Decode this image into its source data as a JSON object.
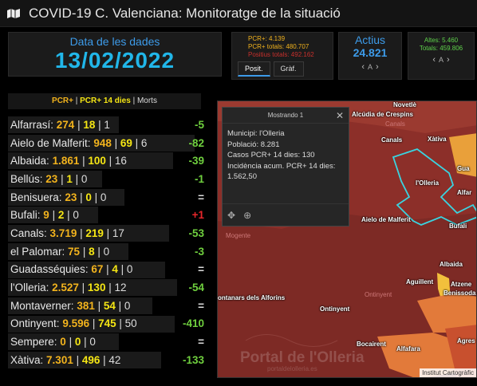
{
  "header": {
    "title": "COVID-19 C. Valenciana: Monitoratge de la situació"
  },
  "date_panel": {
    "label": "Data de les dades",
    "value": "13/02/2022"
  },
  "pcr_panel": {
    "pcr": "PCR+: 4.139",
    "pcr_total": "PCR+ totals: 480.707",
    "positius_total": "Positius totals: 492.162"
  },
  "tabs": [
    {
      "label": "Posit."
    },
    {
      "label": "Gràf."
    }
  ],
  "actius": {
    "label": "Actius",
    "value": "24.821",
    "pager_label": "A"
  },
  "altes": {
    "altes": "Altes: 5.460",
    "totals": "Totals: 459.806",
    "pager_label": "A"
  },
  "legend": {
    "a": "PCR+",
    "sep1": " | ",
    "b": "PCR+ 14 dies",
    "sep2": " | ",
    "c": "Morts"
  },
  "rows": [
    {
      "name": "Alfarrasí",
      "pcr": "274",
      "pcr14": "18",
      "morts": "1",
      "diff": "-5",
      "kind": "neg",
      "bar": 0.55
    },
    {
      "name": "Aielo de Malferit",
      "pcr": "948",
      "pcr14": "69",
      "morts": "6",
      "diff": "-82",
      "kind": "neg",
      "bar": 0.93
    },
    {
      "name": "Albaida",
      "pcr": "1.861",
      "pcr14": "100",
      "morts": "16",
      "diff": "-39",
      "kind": "neg",
      "bar": 0.82
    },
    {
      "name": "Bellús",
      "pcr": "23",
      "pcr14": "1",
      "morts": "0",
      "diff": "-1",
      "kind": "neg",
      "bar": 0.47
    },
    {
      "name": "Benisuera",
      "pcr": "23",
      "pcr14": "0",
      "morts": "0",
      "diff": "=",
      "kind": "eq",
      "bar": 0.58
    },
    {
      "name": "Bufali",
      "pcr": "9",
      "pcr14": "2",
      "morts": "0",
      "diff": "+1",
      "kind": "pos",
      "bar": 0.45
    },
    {
      "name": "Canals",
      "pcr": "3.719",
      "pcr14": "219",
      "morts": "17",
      "diff": "-53",
      "kind": "neg",
      "bar": 0.8
    },
    {
      "name": "el Palomar",
      "pcr": "75",
      "pcr14": "8",
      "morts": "0",
      "diff": "-3",
      "kind": "neg",
      "bar": 0.6
    },
    {
      "name": "Guadasséquies",
      "pcr": "67",
      "pcr14": "4",
      "morts": "0",
      "diff": "=",
      "kind": "eq",
      "bar": 0.78
    },
    {
      "name": "l'Olleria",
      "pcr": "2.527",
      "pcr14": "130",
      "morts": "12",
      "diff": "-54",
      "kind": "neg",
      "bar": 0.84
    },
    {
      "name": "Montaverner",
      "pcr": "381",
      "pcr14": "54",
      "morts": "0",
      "diff": "=",
      "kind": "eq",
      "bar": 0.72
    },
    {
      "name": "Ontinyent",
      "pcr": "9.596",
      "pcr14": "745",
      "morts": "50",
      "diff": "-410",
      "kind": "neg",
      "bar": 0.83
    },
    {
      "name": "Sempere",
      "pcr": "0",
      "pcr14": "0",
      "morts": "0",
      "diff": "=",
      "kind": "eq",
      "bar": 0.55
    },
    {
      "name": "Xàtiva",
      "pcr": "7.301",
      "pcr14": "496",
      "morts": "42",
      "diff": "-133",
      "kind": "neg",
      "bar": 0.76
    }
  ],
  "popup": {
    "header": "Mostrando 1",
    "municipi": "Municipi: l'Olleria",
    "poblacio": "Població: 8.281",
    "casos": "Casos PCR+ 14 dies: 130",
    "incidencia": "Incidència acum. PCR+ 14 dies: 1.562,50"
  },
  "map": {
    "labels": [
      {
        "text": "Novetlè"
      },
      {
        "text": "Alcúdia de Crespins"
      },
      {
        "text": "Canals"
      },
      {
        "text": "Canals"
      },
      {
        "text": "Xàtiva"
      },
      {
        "text": "Gua"
      },
      {
        "text": "l'Olleria"
      },
      {
        "text": "Alfar"
      },
      {
        "text": "Aielo de Malferit"
      },
      {
        "text": "Bufali"
      },
      {
        "text": "Mogente"
      },
      {
        "text": "Albaida"
      },
      {
        "text": "Aguillent"
      },
      {
        "text": "Atzene"
      },
      {
        "text": "Benissoda"
      },
      {
        "text": "ontanars dels Alforins"
      },
      {
        "text": "Ontinyent"
      },
      {
        "text": "Ontinyent"
      },
      {
        "text": "Bocairent"
      },
      {
        "text": "Alfafara"
      },
      {
        "text": "Agres"
      }
    ],
    "watermark": "Portal de l'Olleria",
    "watermark_sub": "portaldelolleria.es",
    "attribution": "Institut Cartogràfic"
  }
}
